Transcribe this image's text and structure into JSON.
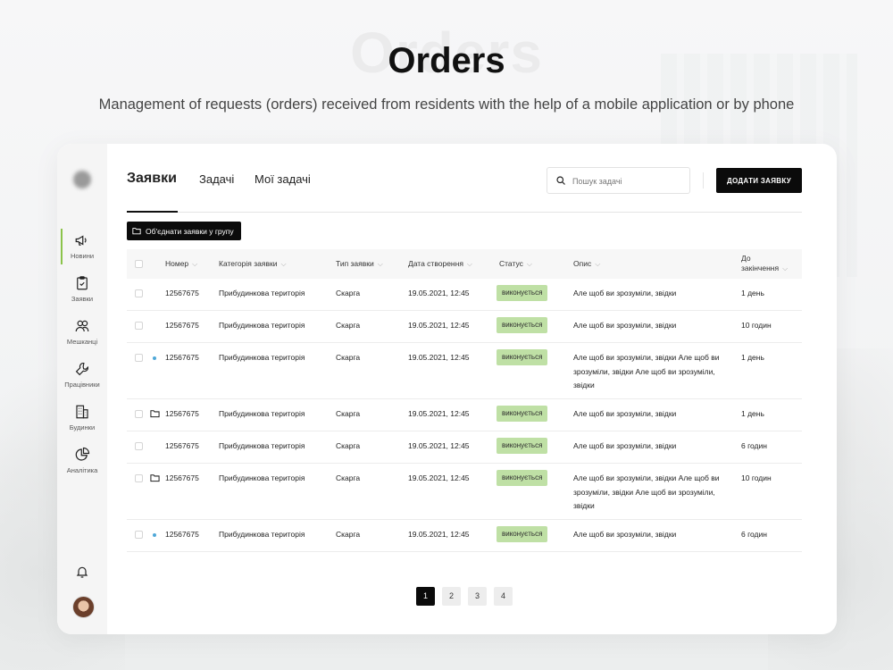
{
  "hero": {
    "title": "Orders",
    "subtitle": "Management of requests (orders) received from residents with the help of a mobile application or by phone"
  },
  "sidebar": {
    "items": [
      {
        "label": "Новини",
        "icon": "megaphone-icon",
        "active": true
      },
      {
        "label": "Заявки",
        "icon": "clipboard-icon",
        "active": false
      },
      {
        "label": "Мешканці",
        "icon": "users-icon",
        "active": false
      },
      {
        "label": "Працівники",
        "icon": "wrench-icon",
        "active": false
      },
      {
        "label": "Будинки",
        "icon": "building-icon",
        "active": false
      },
      {
        "label": "Аналітика",
        "icon": "pie-chart-icon",
        "active": false
      }
    ]
  },
  "tabs": [
    {
      "label": "Заявки",
      "active": true
    },
    {
      "label": "Задачі",
      "active": false
    },
    {
      "label": "Мої задачі",
      "active": false
    }
  ],
  "search": {
    "placeholder": "Пошук задачі",
    "value": ""
  },
  "add_button": "ДОДАТИ ЗАЯВКУ",
  "group_button": "Об'єднати заявки у групу",
  "table": {
    "headers": {
      "number": "Номер",
      "category": "Категорія заявки",
      "type": "Тип заявки",
      "created": "Дата створення",
      "status": "Статус",
      "description": "Опис",
      "deadline_1": "До",
      "deadline_2": "закінчення"
    },
    "rows": [
      {
        "marker": "none",
        "number": "12567675",
        "category": "Прибудинкова територія",
        "type": "Скарга",
        "created": "19.05.2021, 12:45",
        "status": "виконується",
        "description": "Але щоб ви зрозуміли, звідки",
        "deadline": "1 день"
      },
      {
        "marker": "none",
        "number": "12567675",
        "category": "Прибудинкова територія",
        "type": "Скарга",
        "created": "19.05.2021, 12:45",
        "status": "виконується",
        "description": "Але щоб ви зрозуміли, звідки",
        "deadline": "10 годин"
      },
      {
        "marker": "dot",
        "number": "12567675",
        "category": "Прибудинкова територія",
        "type": "Скарга",
        "created": "19.05.2021, 12:45",
        "status": "виконується",
        "description": "Але щоб ви зрозуміли, звідки Але щоб ви зрозуміли, звідки Але щоб ви зрозуміли, звідки",
        "deadline": "1 день"
      },
      {
        "marker": "folder",
        "number": "12567675",
        "category": "Прибудинкова територія",
        "type": "Скарга",
        "created": "19.05.2021, 12:45",
        "status": "виконується",
        "description": "Але щоб ви зрозуміли, звідки",
        "deadline": "1 день"
      },
      {
        "marker": "none",
        "number": "12567675",
        "category": "Прибудинкова територія",
        "type": "Скарга",
        "created": "19.05.2021, 12:45",
        "status": "виконується",
        "description": "Але щоб ви зрозуміли, звідки",
        "deadline": "6 годин"
      },
      {
        "marker": "folder",
        "number": "12567675",
        "category": "Прибудинкова територія",
        "type": "Скарга",
        "created": "19.05.2021, 12:45",
        "status": "виконується",
        "description": "Але щоб ви зрозуміли, звідки Але щоб ви зрозуміли, звідки Але щоб ви зрозуміли, звідки",
        "deadline": "10 годин"
      },
      {
        "marker": "dot",
        "number": "12567675",
        "category": "Прибудинкова територія",
        "type": "Скарга",
        "created": "19.05.2021, 12:45",
        "status": "виконується",
        "description": "Але щоб ви зрозуміли, звідки",
        "deadline": "6 годин"
      }
    ]
  },
  "pagination": {
    "pages": [
      "1",
      "2",
      "3",
      "4"
    ],
    "current": "1"
  },
  "colors": {
    "accent": "#0b0b0b",
    "status_bg": "#bfe0a5",
    "active_nav": "#8bc34a",
    "new_dot": "#4fa8d8"
  }
}
